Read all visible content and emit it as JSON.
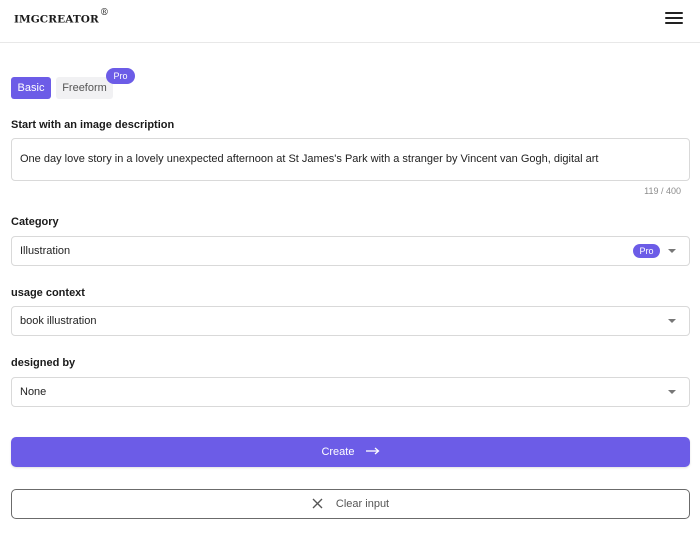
{
  "header": {
    "logo": "IMGCREATOR",
    "logo_mark": "®",
    "menu_icon": "hamburger-icon"
  },
  "tabs": {
    "basic": "Basic",
    "freeform": "Freeform",
    "pro_badge": "Pro",
    "active": "Basic"
  },
  "description": {
    "label": "Start with an image description",
    "value": "One day love story in a lovely unexpected afternoon at St James's Park with a stranger by Vincent van Gogh, digital art",
    "counter": "119 / 400"
  },
  "category": {
    "label": "Category",
    "value": "Illustration",
    "pro_badge": "Pro"
  },
  "usage_context": {
    "label": "usage context",
    "value": "book illustration"
  },
  "designed_by": {
    "label": "designed by",
    "value": "None"
  },
  "actions": {
    "create_label": "Create",
    "create_icon": "arrow-right-icon",
    "clear_label": "Clear input",
    "clear_icon": "close-icon"
  },
  "colors": {
    "accent": "#6c5ce7",
    "border": "#d9d9d9"
  }
}
